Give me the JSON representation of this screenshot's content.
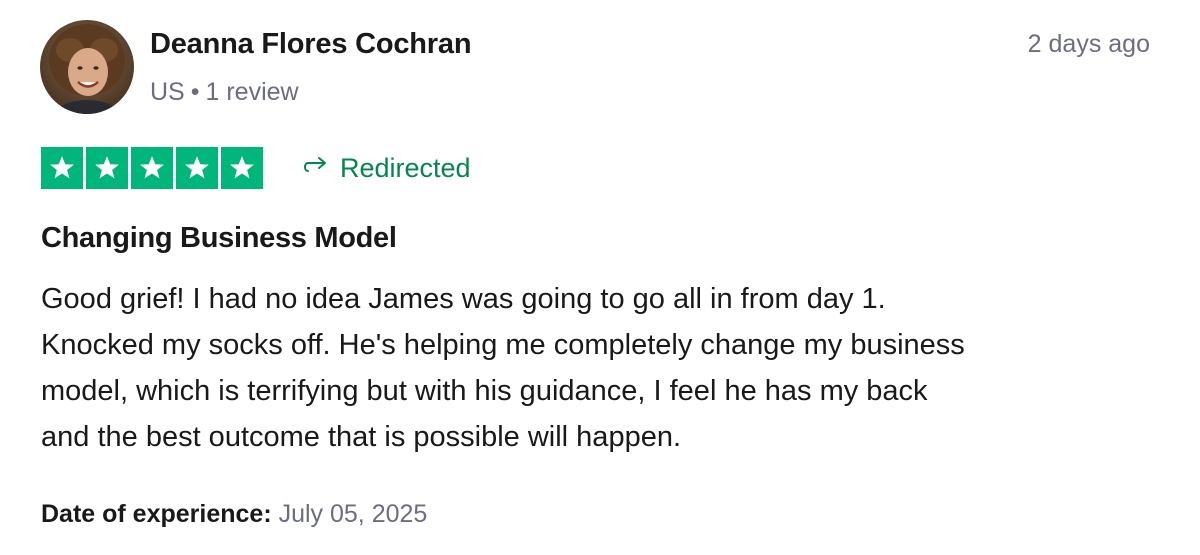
{
  "reviewer": {
    "name": "Deanna Flores Cochran",
    "country": "US",
    "separator": "•",
    "review_count": "1 review",
    "avatar_icon": "user-avatar-photo"
  },
  "posted": "2 days ago",
  "rating": {
    "stars": 5,
    "max": 5,
    "color": "#00b67a"
  },
  "redirected": {
    "label": "Redirected",
    "icon": "redirect-arrow-icon",
    "color": "#04864c"
  },
  "review": {
    "title": "Changing Business Model",
    "body_lines": [
      "Good grief! I had no idea James was going to go all in from day 1.",
      "Knocked my socks off. He's helping me completely change my business",
      "model, which is terrifying but with his guidance, I feel he has my back",
      "and the best outcome that is possible will happen."
    ]
  },
  "experience": {
    "label": "Date of experience:",
    "date": "July 05, 2025"
  }
}
